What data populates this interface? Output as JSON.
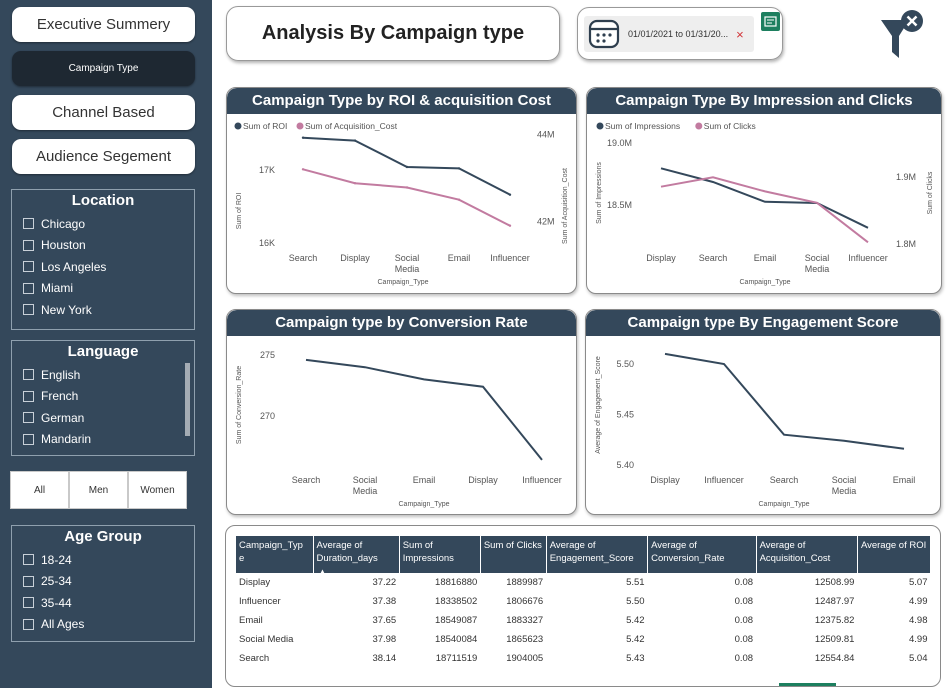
{
  "nav": {
    "executive_summary": "Executive Summery",
    "campaign_type": "Campaign Type",
    "channel_based": "Channel Based",
    "audience_segment": "Audience Segement"
  },
  "filters": {
    "location": {
      "title": "Location",
      "options": [
        "Chicago",
        "Houston",
        "Los Angeles",
        "Miami",
        "New York"
      ]
    },
    "language": {
      "title": "Language",
      "options": [
        "English",
        "French",
        "German",
        "Mandarin"
      ]
    },
    "gender": [
      "All",
      "Men",
      "Women"
    ],
    "age_group": {
      "title": "Age Group",
      "options": [
        "18-24",
        "25-34",
        "35-44",
        "All Ages"
      ]
    }
  },
  "header": {
    "title": "Analysis By Campaign type",
    "date_range": "01/01/2021 to 01/31/20...",
    "clear_symbol": "×"
  },
  "colors": {
    "navy": "#34485b",
    "pink": "#c27ba0",
    "sidebar": "#34485b",
    "active_nav": "#1e2832",
    "accent_green": "#1d7f5f"
  },
  "charts": {
    "roi_acq": {
      "title": "Campaign Type by ROI & acquisition Cost",
      "legend": [
        "Sum of ROI",
        "Sum of Acquisition_Cost"
      ],
      "y_left_label": "Sum of ROI",
      "y_right_label": "Sum of Acquisition_Cost",
      "x_label": "Campaign_Type",
      "y_left_ticks": [
        "17K",
        "16K"
      ],
      "y_right_ticks": [
        "44M",
        "42M"
      ],
      "x_ticks": [
        "Search",
        "Display",
        "Social Media",
        "Email",
        "Influencer"
      ]
    },
    "impr_clicks": {
      "title": "Campaign Type By Impression and Clicks",
      "legend": [
        "Sum of Impressions",
        "Sum of Clicks"
      ],
      "y_left_label": "Sum of Impressions",
      "y_right_label": "Sum of Clicks",
      "x_label": "Campaign_Type",
      "y_left_ticks": [
        "19.0M",
        "18.5M"
      ],
      "y_right_ticks": [
        "1.9M",
        "1.8M"
      ],
      "x_ticks": [
        "Display",
        "Search",
        "Email",
        "Social Media",
        "Influencer"
      ]
    },
    "conversion": {
      "title": "Campaign type by Conversion Rate",
      "y_label": "Sum of Conversion_Rate",
      "x_label": "Campaign_Type",
      "y_ticks": [
        "275",
        "270"
      ],
      "x_ticks": [
        "Search",
        "Social Media",
        "Email",
        "Display",
        "Influencer"
      ]
    },
    "engagement": {
      "title": "Campaign type By Engagement Score",
      "y_label": "Average of Engagement_Score",
      "x_label": "Campaign_Type",
      "y_ticks": [
        "5.50",
        "5.45",
        "5.40"
      ],
      "x_ticks": [
        "Display",
        "Influencer",
        "Search",
        "Social Media",
        "Email"
      ]
    }
  },
  "chart_data": [
    {
      "type": "line",
      "title": "Campaign Type by ROI & acquisition Cost",
      "categories": [
        "Search",
        "Display",
        "Social Media",
        "Email",
        "Influencer"
      ],
      "series": [
        {
          "name": "Sum of ROI",
          "axis": "left",
          "values": [
            17440,
            17400,
            17040,
            17020,
            16660
          ]
        },
        {
          "name": "Sum of Acquisition_Cost",
          "axis": "right",
          "values": [
            43.2,
            42.88,
            42.78,
            42.5,
            41.9
          ]
        }
      ],
      "xlabel": "Campaign_Type",
      "ylabel": "Sum of ROI",
      "y2label": "Sum of Acquisition_Cost",
      "ylim": [
        16000,
        17600
      ],
      "y2lim": [
        41.5,
        44.2
      ],
      "y2_unit": "M"
    },
    {
      "type": "line",
      "title": "Campaign Type By Impression and Clicks",
      "categories": [
        "Display",
        "Search",
        "Email",
        "Social Media",
        "Influencer"
      ],
      "series": [
        {
          "name": "Sum of Impressions",
          "axis": "left",
          "values": [
            18.82,
            18.71,
            18.55,
            18.54,
            18.34
          ]
        },
        {
          "name": "Sum of Clicks",
          "axis": "right",
          "values": [
            1.89,
            1.904,
            1.883,
            1.866,
            1.807
          ]
        }
      ],
      "xlabel": "Campaign_Type",
      "ylabel": "Sum of Impressions",
      "y2label": "Sum of Clicks",
      "ylim": [
        18.25,
        19.0
      ],
      "y2lim": [
        1.8,
        1.95
      ],
      "y_unit": "M",
      "y2_unit": "M"
    },
    {
      "type": "line",
      "title": "Campaign type by Conversion Rate",
      "categories": [
        "Search",
        "Social Media",
        "Email",
        "Display",
        "Influencer"
      ],
      "series": [
        {
          "name": "Sum of Conversion_Rate",
          "values": [
            274.6,
            274.0,
            273.0,
            272.4,
            266.4
          ]
        }
      ],
      "xlabel": "Campaign_Type",
      "ylabel": "Sum of Conversion_Rate",
      "ylim": [
        265.5,
        276.5
      ]
    },
    {
      "type": "line",
      "title": "Campaign type By Engagement Score",
      "categories": [
        "Display",
        "Influencer",
        "Search",
        "Social Media",
        "Email"
      ],
      "series": [
        {
          "name": "Average of Engagement_Score",
          "values": [
            5.51,
            5.5,
            5.43,
            5.424,
            5.416
          ]
        }
      ],
      "xlabel": "Campaign_Type",
      "ylabel": "Average of Engagement_Score",
      "ylim": [
        5.395,
        5.515
      ]
    },
    {
      "type": "table",
      "columns": [
        "Campaign_Type",
        "Average of Duration_days",
        "Sum of Impressions",
        "Sum of Clicks",
        "Average of Engagement_Score",
        "Average of Conversion_Rate",
        "Average of Acquisition_Cost",
        "Average of ROI"
      ],
      "rows": [
        [
          "Display",
          "37.22",
          "18816880",
          "1889987",
          "5.51",
          "0.08",
          "12508.99",
          "5.07"
        ],
        [
          "Influencer",
          "37.38",
          "18338502",
          "1806676",
          "5.50",
          "0.08",
          "12487.97",
          "4.99"
        ],
        [
          "Email",
          "37.65",
          "18549087",
          "1883327",
          "5.42",
          "0.08",
          "12375.82",
          "4.98"
        ],
        [
          "Social Media",
          "37.98",
          "18540084",
          "1865623",
          "5.42",
          "0.08",
          "12509.81",
          "4.99"
        ],
        [
          "Search",
          "38.14",
          "18711519",
          "1904005",
          "5.43",
          "0.08",
          "12554.84",
          "5.04"
        ]
      ]
    }
  ],
  "table": {
    "headers": [
      "Campaign_Typ e",
      "Average of Duration_days",
      "Sum of Impressions",
      "Sum of Clicks",
      "Average of Engagement_Score",
      "Average of Conversion_Rate",
      "Average of Acquisition_Cost",
      "Average of ROI"
    ],
    "rows": [
      [
        "Display",
        "37.22",
        "18816880",
        "1889987",
        "5.51",
        "0.08",
        "12508.99",
        "5.07"
      ],
      [
        "Influencer",
        "37.38",
        "18338502",
        "1806676",
        "5.50",
        "0.08",
        "12487.97",
        "4.99"
      ],
      [
        "Email",
        "37.65",
        "18549087",
        "1883327",
        "5.42",
        "0.08",
        "12375.82",
        "4.98"
      ],
      [
        "Social Media",
        "37.98",
        "18540084",
        "1865623",
        "5.42",
        "0.08",
        "12509.81",
        "4.99"
      ],
      [
        "Search",
        "38.14",
        "18711519",
        "1904005",
        "5.43",
        "0.08",
        "12554.84",
        "5.04"
      ]
    ]
  }
}
